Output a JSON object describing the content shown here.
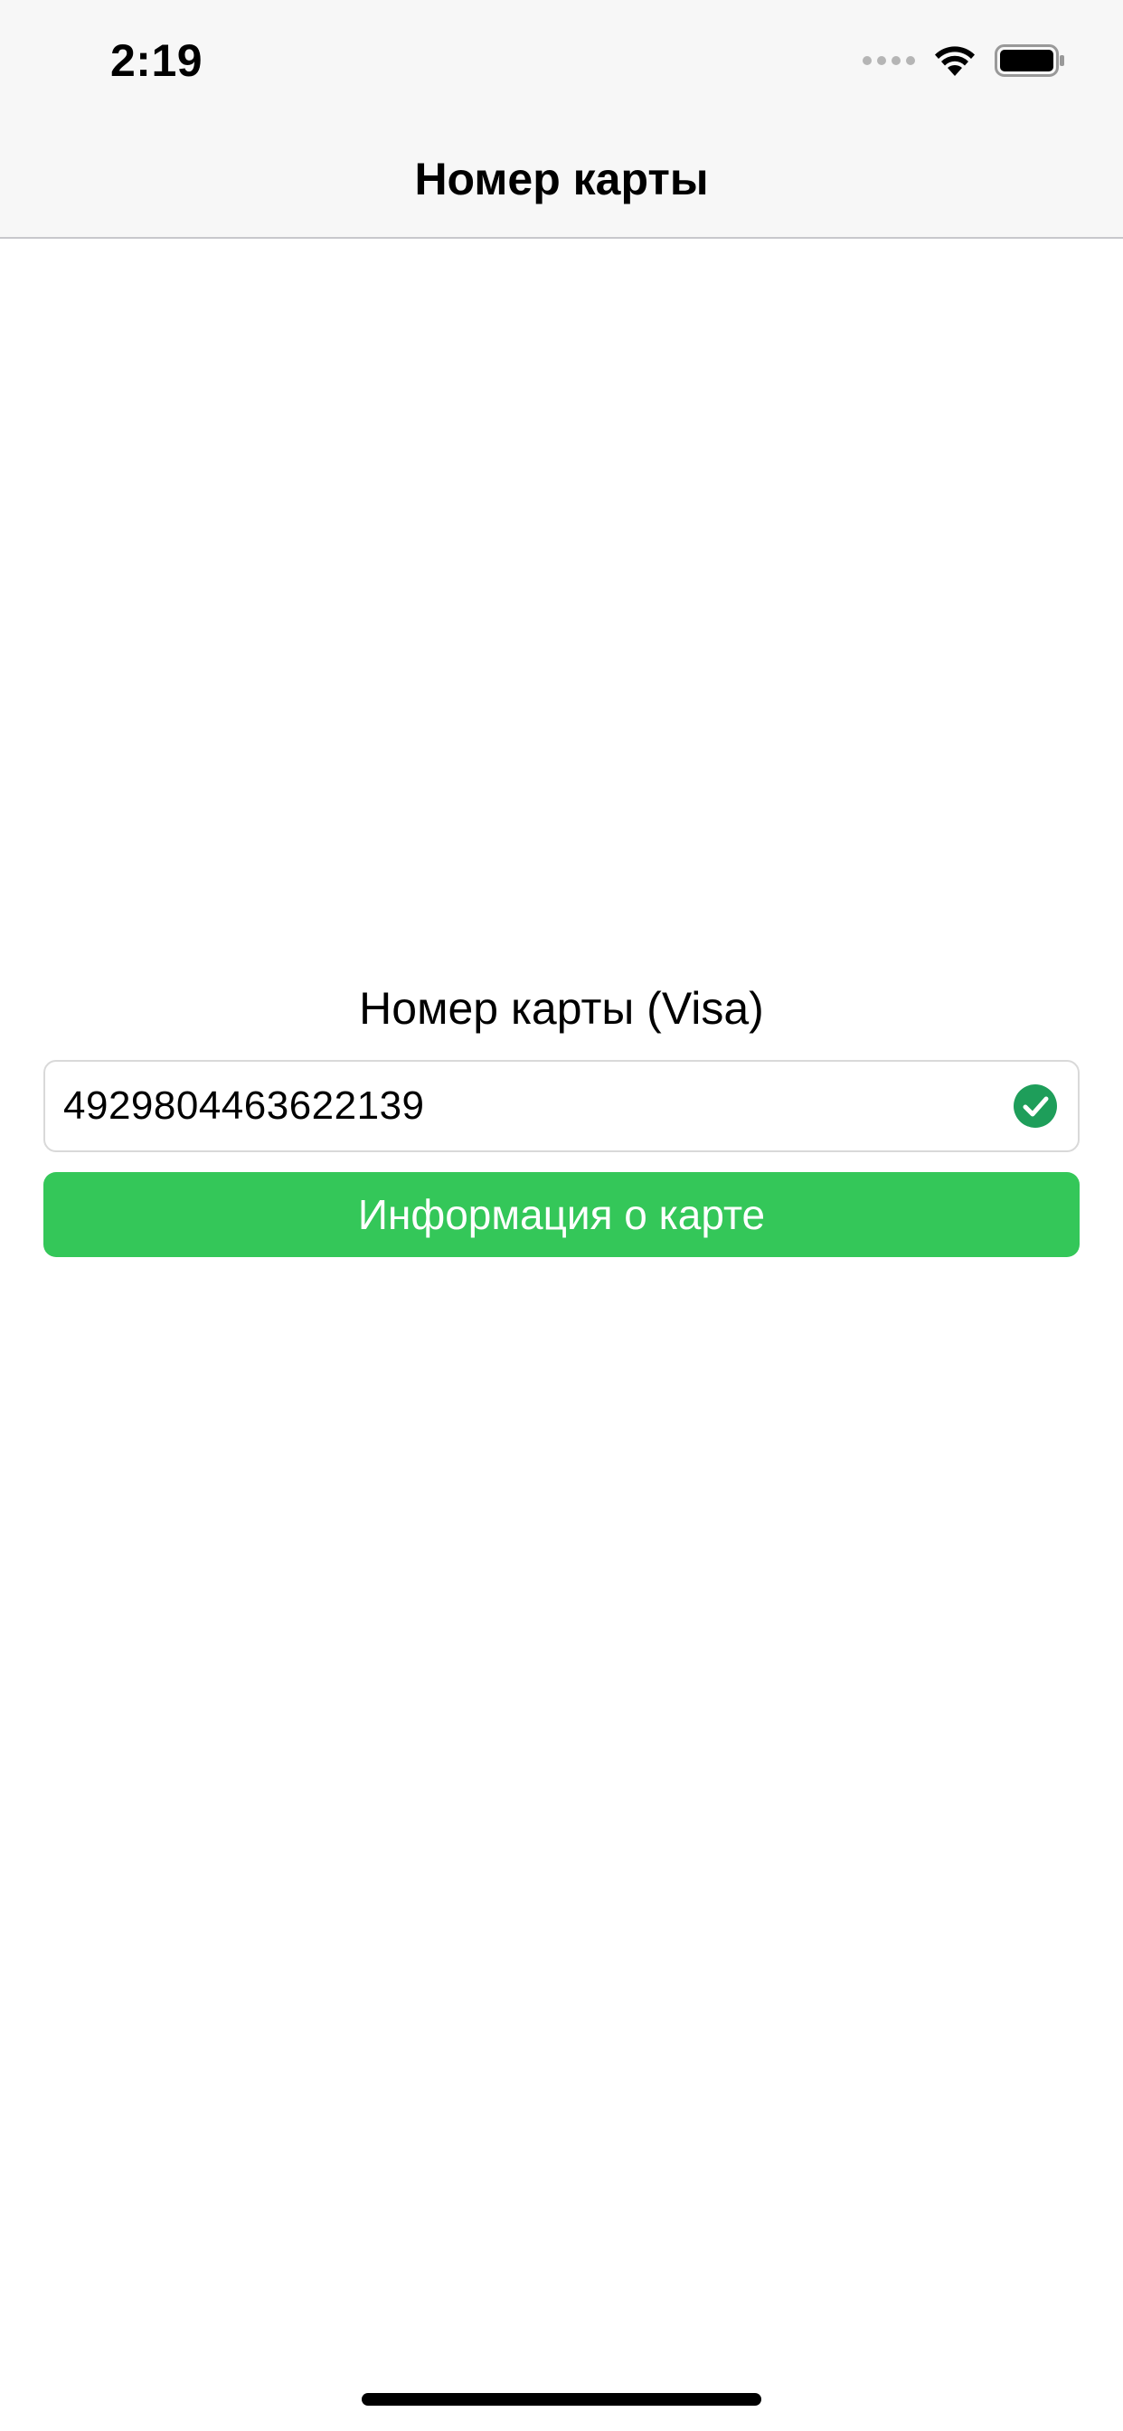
{
  "status_bar": {
    "time": "2:19",
    "signal_icon": "signal-dots-icon",
    "wifi_icon": "wifi-icon",
    "battery_icon": "battery-icon"
  },
  "nav": {
    "title": "Номер карты"
  },
  "form": {
    "label": "Номер карты (Visa)",
    "card_number": "4929804463622139",
    "valid_icon": "check-circle-icon",
    "button_label": "Информация о карте"
  },
  "colors": {
    "accent_green": "#34C759",
    "valid_green": "#1E9E5A"
  }
}
